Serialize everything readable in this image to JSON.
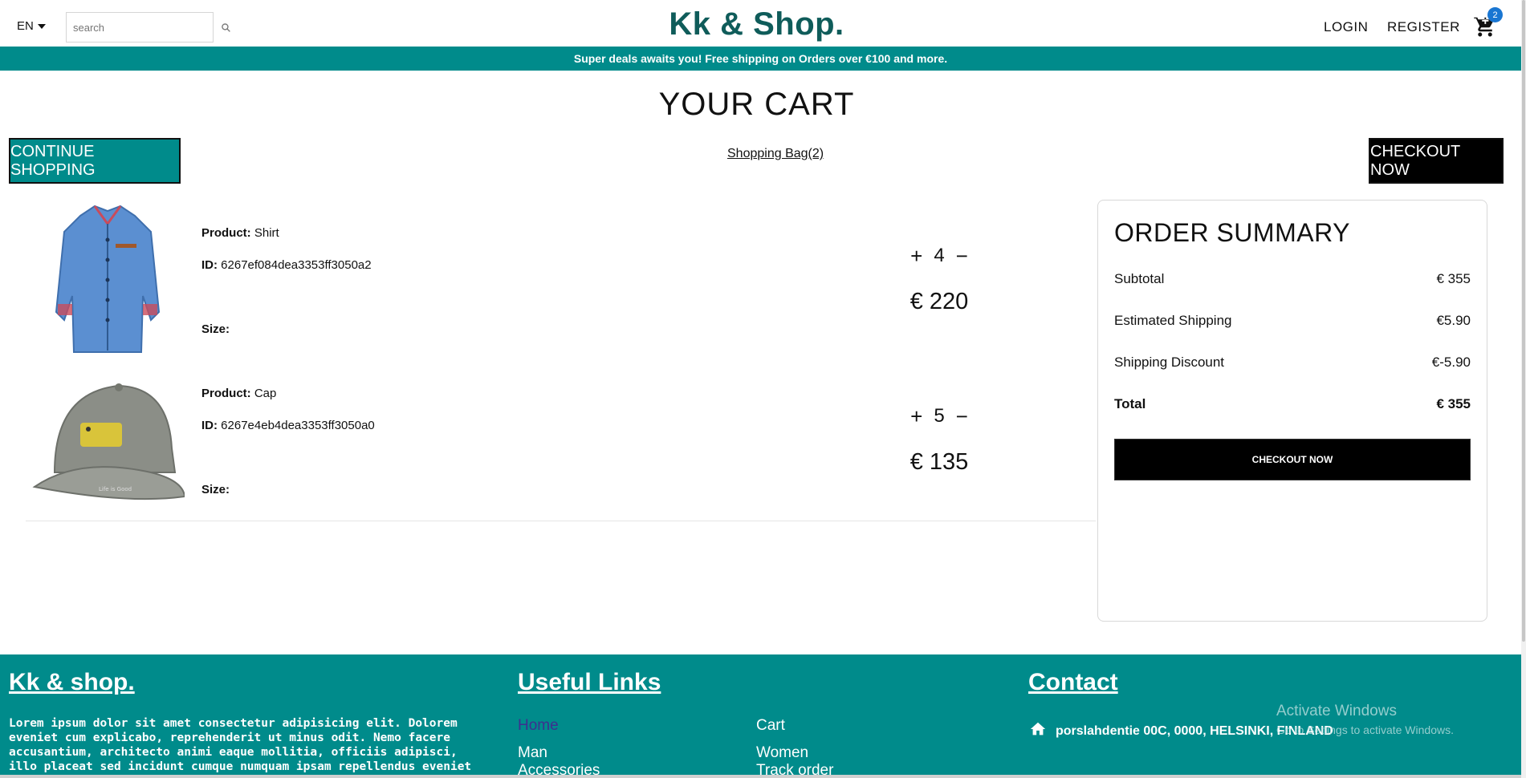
{
  "header": {
    "language": "EN",
    "search_placeholder": "search",
    "logo": "Kk & Shop.",
    "login_label": "LOGIN",
    "register_label": "REGISTER",
    "cart_count": "2"
  },
  "announcement": "Super deals awaits you! Free shipping on Orders over €100 and more.",
  "cart_page": {
    "title": "YOUR CART",
    "continue_label": "CONTINUE SHOPPING",
    "bag_label": "Shopping Bag(2)",
    "checkout_top_label": "CHECKOUT NOW"
  },
  "items": [
    {
      "product_label": "Product:",
      "product_name": "Shirt",
      "id_label": "ID:",
      "id_value": "6267ef084dea3353ff3050a2",
      "size_label": "Size:",
      "quantity": "4",
      "price": "€ 220"
    },
    {
      "product_label": "Product:",
      "product_name": "Cap",
      "id_label": "ID:",
      "id_value": "6267e4eb4dea3353ff3050a0",
      "size_label": "Size:",
      "quantity": "5",
      "price": "€ 135"
    }
  ],
  "summary": {
    "title": "ORDER SUMMARY",
    "subtotal_label": "Subtotal",
    "subtotal_value": "€ 355",
    "shipping_label": "Estimated Shipping",
    "shipping_value": "€5.90",
    "discount_label": "Shipping Discount",
    "discount_value": "€-5.90",
    "total_label": "Total",
    "total_value": "€ 355",
    "checkout_label": "CHECKOUT NOW"
  },
  "footer": {
    "brand": "Kk & shop.",
    "description": "Lorem ipsum dolor sit amet consectetur adipisicing elit. Dolorem eveniet cum explicabo, reprehenderit ut minus odit. Nemo facere accusantium, architecto animi eaque mollitia, officiis adipisci, illo placeat sed incidunt cumque numquam ipsam repellendus eveniet eos. Non quod accusantium,",
    "links_title": "Useful Links",
    "links": [
      "Home",
      "Cart",
      "Man",
      "Women",
      "Accessories",
      "Track order"
    ],
    "contact_title": "Contact",
    "address": "porslahdentie 00C, 0000, HELSINKI, FINLAND"
  },
  "watermark": {
    "line1": "Activate Windows",
    "line2": "Go to Settings to activate Windows."
  },
  "colors": {
    "teal": "#008b8b",
    "logo": "#0f5c5a",
    "badge": "#1976d2"
  }
}
